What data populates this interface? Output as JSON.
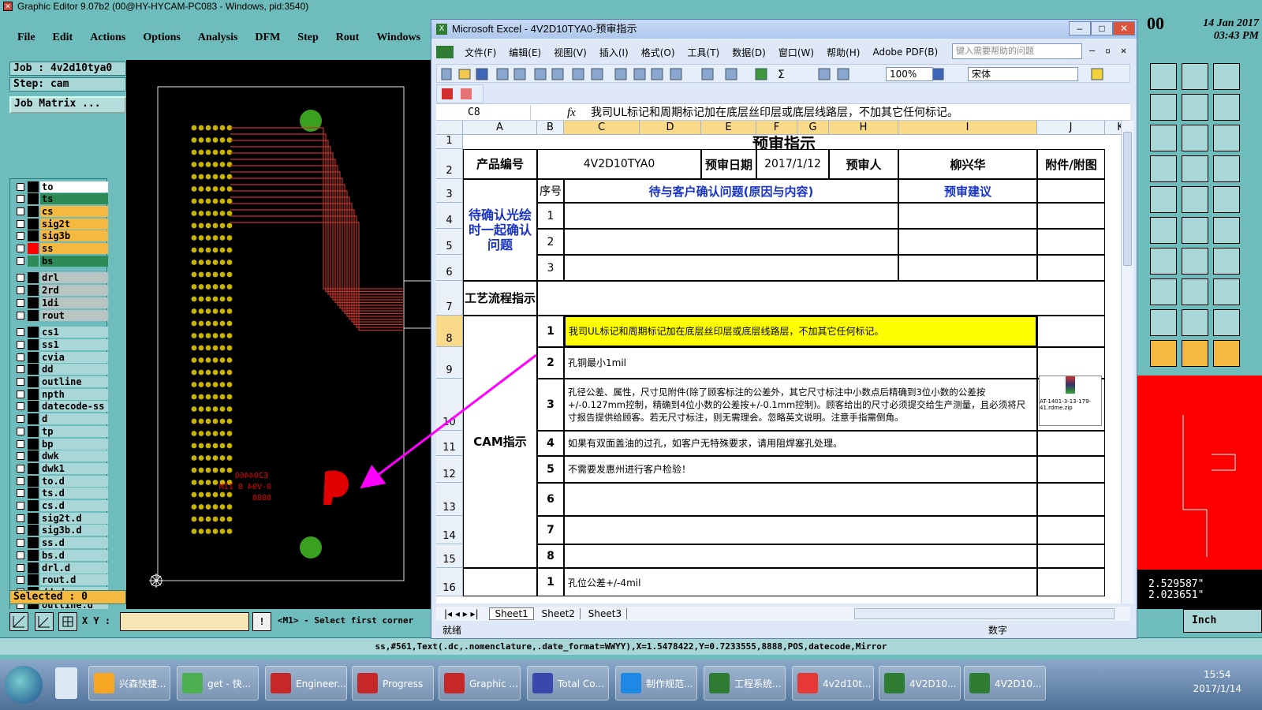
{
  "ge": {
    "title": "Graphic Editor 9.07b2 (00@HY-HYCAM-PC083 - Windows, pid:3540)",
    "menu": [
      "File",
      "Edit",
      "Actions",
      "Options",
      "Analysis",
      "DFM",
      "Step",
      "Rout",
      "Windows"
    ],
    "clock_date": "14 Jan 2017",
    "clock_time": "03:43 PM",
    "clock_partial": "00",
    "job": "Job  : 4v2d10tya0",
    "step": "Step: cam",
    "job_matrix": "Job Matrix ...",
    "layers": [
      {
        "name": "to",
        "color": "#ffffff",
        "swatch": "#000000"
      },
      {
        "name": "ts",
        "color": "#2e8b57",
        "swatch": "#000000"
      },
      {
        "name": "cs",
        "color": "#f5b942",
        "swatch": "#000000"
      },
      {
        "name": "sig2t",
        "color": "#f5b942",
        "swatch": "#000000"
      },
      {
        "name": "sig3b",
        "color": "#f5b942",
        "swatch": "#000000"
      },
      {
        "name": "ss",
        "color": "#f5b942",
        "swatch": "#ff0000"
      },
      {
        "name": "bs",
        "color": "#2e8b57",
        "swatch": "#2e8b57"
      },
      {
        "name": "drl",
        "color": "#b8c4c4",
        "swatch": "#000000"
      },
      {
        "name": "2rd",
        "color": "#b8c4c4",
        "swatch": "#000000"
      },
      {
        "name": "1di",
        "color": "#b8c4c4",
        "swatch": "#000000"
      },
      {
        "name": "rout",
        "color": "#b8c4c4",
        "swatch": "#000000"
      },
      {
        "name": "cs1",
        "color": "#a9d6d6",
        "swatch": "#000000"
      },
      {
        "name": "ss1",
        "color": "#a9d6d6",
        "swatch": "#000000"
      },
      {
        "name": "cvia",
        "color": "#a9d6d6",
        "swatch": "#000000"
      },
      {
        "name": "dd",
        "color": "#a9d6d6",
        "swatch": "#000000"
      },
      {
        "name": "outline",
        "color": "#a9d6d6",
        "swatch": "#000000"
      },
      {
        "name": "npth",
        "color": "#a9d6d6",
        "swatch": "#000000"
      },
      {
        "name": "datecode-ss",
        "color": "#a9d6d6",
        "swatch": "#000000"
      },
      {
        "name": "d",
        "color": "#a9d6d6",
        "swatch": "#000000"
      },
      {
        "name": "tp",
        "color": "#a9d6d6",
        "swatch": "#000000"
      },
      {
        "name": "bp",
        "color": "#a9d6d6",
        "swatch": "#000000"
      },
      {
        "name": "dwk",
        "color": "#a9d6d6",
        "swatch": "#000000"
      },
      {
        "name": "dwk1",
        "color": "#a9d6d6",
        "swatch": "#000000"
      },
      {
        "name": "to.d",
        "color": "#a9d6d6",
        "swatch": "#000000"
      },
      {
        "name": "ts.d",
        "color": "#a9d6d6",
        "swatch": "#000000"
      },
      {
        "name": "cs.d",
        "color": "#a9d6d6",
        "swatch": "#000000"
      },
      {
        "name": "sig2t.d",
        "color": "#a9d6d6",
        "swatch": "#000000"
      },
      {
        "name": "sig3b.d",
        "color": "#a9d6d6",
        "swatch": "#000000"
      },
      {
        "name": "ss.d",
        "color": "#a9d6d6",
        "swatch": "#000000"
      },
      {
        "name": "bs.d",
        "color": "#a9d6d6",
        "swatch": "#000000"
      },
      {
        "name": "drl.d",
        "color": "#a9d6d6",
        "swatch": "#000000"
      },
      {
        "name": "rout.d",
        "color": "#a9d6d6",
        "swatch": "#000000"
      },
      {
        "name": "dd.d",
        "color": "#a9d6d6",
        "swatch": "#000000"
      },
      {
        "name": "outline.d",
        "color": "#a9d6d6",
        "swatch": "#000000"
      }
    ],
    "selected": "Selected : 0",
    "xy_label": "X Y :",
    "prompt": "<M1> - Select first corner",
    "command": "ss,#561,Text(.dc,.nomenclature,.date_format=WWYY),X=1.5478422,Y=0.7233555,8888,POS,datecode,Mirror",
    "coord_x": "2.529587\"",
    "coord_y": "2.023651\"",
    "units": "Inch",
    "silk_text": [
      "E204460",
      "0-V94 8 IIM",
      "8888"
    ]
  },
  "excel": {
    "title": "Microsoft Excel - 4V2D10TYA0-预审指示",
    "menu": [
      "文件(F)",
      "编辑(E)",
      "视图(V)",
      "插入(I)",
      "格式(O)",
      "工具(T)",
      "数据(D)",
      "窗口(W)",
      "帮助(H)",
      "Adobe PDF(B)"
    ],
    "help_placeholder": "键入需要帮助的问题",
    "zoom": "100%",
    "font": "宋体",
    "name_box": "C8",
    "fx": "fx",
    "formula": "我司UL标记和周期标记加在底层丝印层或底层线路层，不加其它任何标记。",
    "columns": [
      "A",
      "B",
      "C",
      "D",
      "E",
      "F",
      "G",
      "H",
      "I",
      "J",
      "K"
    ],
    "rows": [
      "1",
      "2",
      "3",
      "4",
      "5",
      "6",
      "7",
      "8",
      "9",
      "10",
      "11",
      "12",
      "13",
      "14",
      "15",
      "16"
    ],
    "sheet_title": "预审指示",
    "product_label": "产品编号",
    "product_value": "4V2D10TYA0",
    "date_label": "预审日期",
    "date_value": "2017/1/12",
    "reviewer_label": "预审人",
    "reviewer_value": "柳兴华",
    "attach_label": "附件/附图",
    "confirm_label": "待确认光绘时一起确认问题",
    "seq_label": "序号",
    "issue_header": "待与客户确认问题(原因与内容)",
    "suggest_header": "预审建议",
    "process_label": "工艺流程指示",
    "cam_label": "CAM指示",
    "confirm_nums": [
      "1",
      "2",
      "3"
    ],
    "cam_items": [
      {
        "n": "1",
        "text": "我司UL标记和周期标记加在底层丝印层或底层线路层，不加其它任何标记。"
      },
      {
        "n": "2",
        "text": "孔铜最小1mil"
      },
      {
        "n": "3",
        "text": "孔径公差、属性，尺寸见附件(除了顾客标注的公差外，其它尺寸标注中小数点后精确到3位小数的公差按+/-0.127mm控制，精确到4位小数的公差按+/-0.1mm控制)。顾客给出的尺寸必须提交给生产测量，且必须将尺寸报告提供给顾客。若无尺寸标注，则无需理会。忽略英文说明。注意手指需倒角。"
      },
      {
        "n": "4",
        "text": "如果有双面盖油的过孔，如客户无特殊要求，请用阻焊塞孔处理。"
      },
      {
        "n": "5",
        "text": "不需要发惠州进行客户检验！"
      },
      {
        "n": "6",
        "text": ""
      },
      {
        "n": "7",
        "text": ""
      },
      {
        "n": "8",
        "text": ""
      }
    ],
    "last_row": {
      "n": "1",
      "text": "孔位公差+/-4mil"
    },
    "attachment_caption": "AT-1401-3-13-179-41.rdme.zip",
    "sheets": [
      "Sheet1",
      "Sheet2",
      "Sheet3"
    ],
    "status_left": "就绪",
    "status_right": "数字"
  },
  "taskbar": {
    "items": [
      {
        "label": "兴森快捷...",
        "color": "#f6a623"
      },
      {
        "label": "get - 快...",
        "color": "#4caf50"
      },
      {
        "label": "Engineer...",
        "color": "#c62828"
      },
      {
        "label": "Progress",
        "color": "#c62828"
      },
      {
        "label": "Graphic ...",
        "color": "#c62828"
      },
      {
        "label": "Total Co...",
        "color": "#3949ab"
      },
      {
        "label": "制作规范...",
        "color": "#1e88e5"
      },
      {
        "label": "工程系统...",
        "color": "#2e7d32"
      },
      {
        "label": "4v2d10t...",
        "color": "#e53935"
      },
      {
        "label": "4V2D10...",
        "color": "#2e7d32"
      },
      {
        "label": "4V2D10...",
        "color": "#2e7d32"
      }
    ],
    "time": "15:54",
    "date": "2017/1/14"
  }
}
